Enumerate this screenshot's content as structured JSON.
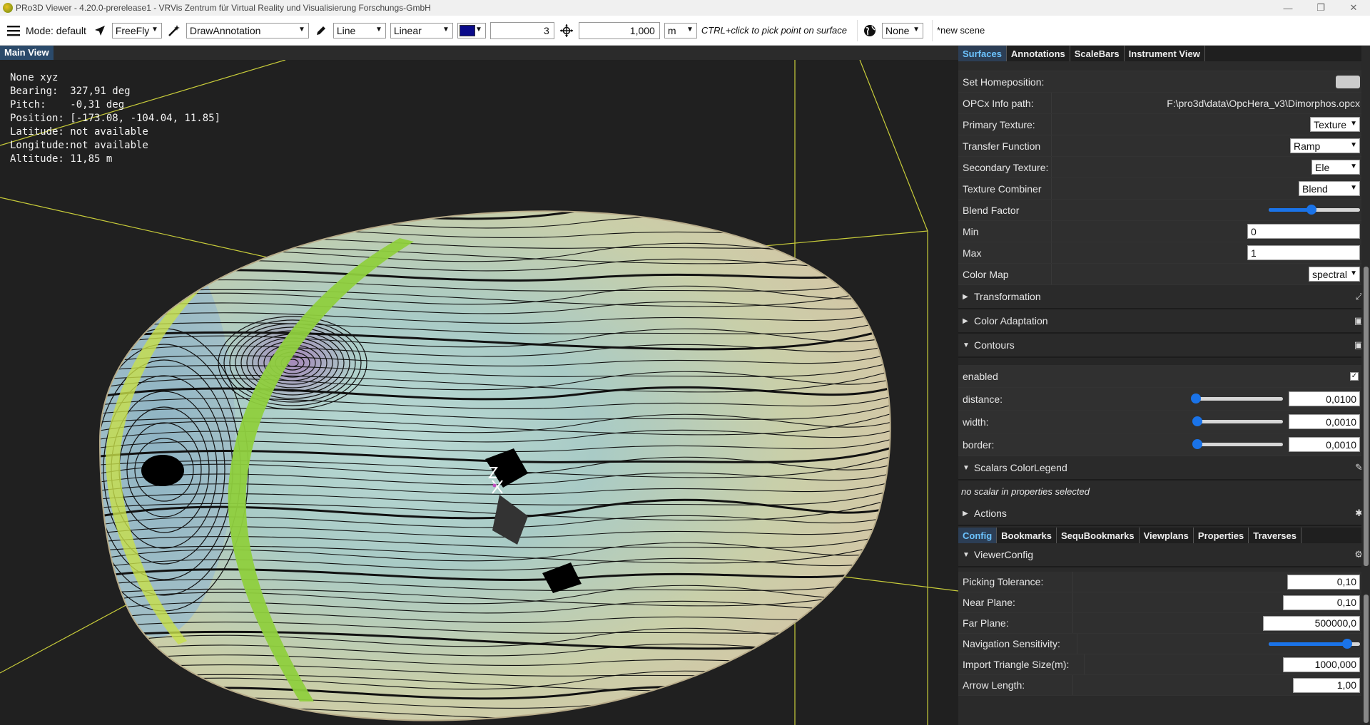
{
  "window": {
    "title": "PRo3D Viewer - 4.20.0-prerelease1 - VRVis Zentrum für Virtual Reality und Visualisierung Forschungs-GmbH"
  },
  "toolbar": {
    "mode_label": "Mode: default",
    "nav_mode": "FreeFly",
    "interaction": "DrawAnnotation",
    "geometry": "Line",
    "projection": "Linear",
    "color_swatch": "#0a0a8a",
    "thickness": "3",
    "distance": "1,000",
    "unit": "m",
    "hint": "CTRL+click to pick point on surface",
    "planet": "None",
    "scene_name": "*new scene"
  },
  "viewport": {
    "tab_label": "Main View",
    "overlay_lines": [
      "None xyz",
      "Bearing:  327,91 deg",
      "Pitch:    -0,31 deg",
      "Position: [-173.08, -104.04, 11.85]",
      "Latitude: not available",
      "Longitude:not available",
      "Altitude: 11,85 m"
    ]
  },
  "panel": {
    "top_tabs": [
      "Surfaces",
      "Annotations",
      "ScaleBars",
      "Instrument View"
    ],
    "rows": {
      "set_homeposition": "Set Homeposition:",
      "opcx_label": "OPCx Info path:",
      "opcx_value": "F:\\pro3d\\data\\OpcHera_v3\\Dimorphos.opcx",
      "primary_texture_label": "Primary Texture:",
      "primary_texture_value": "Texture",
      "transfer_label": "Transfer Function",
      "transfer_value": "Ramp",
      "secondary_label": "Secondary Texture:",
      "secondary_value": "Ele",
      "combiner_label": "Texture Combiner",
      "combiner_value": "Blend",
      "blend_label": "Blend Factor",
      "blend_level": 0.47,
      "min_label": "Min",
      "min_value": "0",
      "max_label": "Max",
      "max_value": "1",
      "colormap_label": "Color Map",
      "colormap_value": "spectral"
    },
    "sections": {
      "transformation": "Transformation",
      "color_adaptation": "Color Adaptation",
      "contours": "Contours",
      "scalars_legend": "Scalars ColorLegend",
      "actions": "Actions",
      "viewer_config": "ViewerConfig"
    },
    "contours": {
      "enabled_label": "enabled",
      "distance_label": "distance:",
      "distance_value": "0,0100",
      "width_label": "width:",
      "width_value": "0,0010",
      "border_label": "border:",
      "border_value": "0,0010"
    },
    "no_scalar": "no scalar in properties selected",
    "bottom_tabs": [
      "Config",
      "Bookmarks",
      "SequBookmarks",
      "Viewplans",
      "Properties",
      "Traverses"
    ],
    "config": {
      "picking_label": "Picking Tolerance:",
      "picking_value": "0,10",
      "near_label": "Near Plane:",
      "near_value": "0,10",
      "far_label": "Far Plane:",
      "far_value": "500000,0",
      "nav_sens_label": "Navigation Sensitivity:",
      "nav_sens_level": 0.86,
      "import_label": "Import Triangle Size(m):",
      "import_value": "1000,000",
      "arrow_label": "Arrow Length:",
      "arrow_value": "1,00"
    }
  }
}
